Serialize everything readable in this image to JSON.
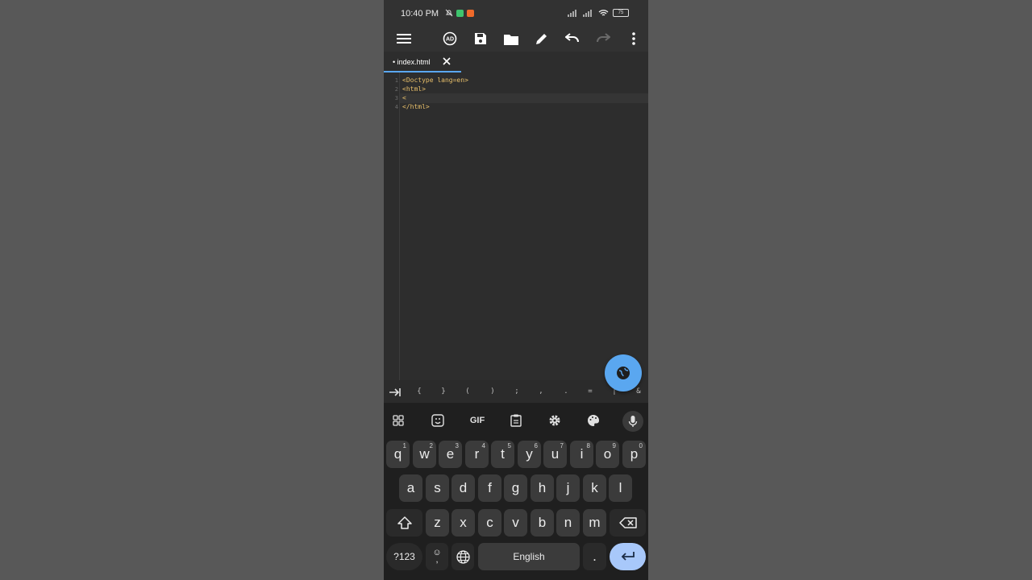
{
  "status": {
    "time": "10:40 PM",
    "battery": "75"
  },
  "toolbar": {
    "icons": [
      "menu-icon",
      "ad-icon",
      "save-icon",
      "folder-icon",
      "pencil-icon",
      "undo-icon",
      "redo-icon",
      "more-vert-icon"
    ]
  },
  "tabs": [
    {
      "label": "• index.html"
    }
  ],
  "editor": {
    "line_numbers": [
      "1",
      "2",
      "3",
      "4"
    ],
    "lines": [
      "<Doctype lang=en>",
      "<html>",
      "<",
      "</html>"
    ]
  },
  "symbols": [
    "{",
    "}",
    "(",
    ")",
    ";",
    ",",
    ".",
    "=",
    "|",
    "&"
  ],
  "keyboard": {
    "gif_label": "GIF",
    "row1": [
      {
        "k": "q",
        "h": "1"
      },
      {
        "k": "w",
        "h": "2"
      },
      {
        "k": "e",
        "h": "3"
      },
      {
        "k": "r",
        "h": "4"
      },
      {
        "k": "t",
        "h": "5"
      },
      {
        "k": "y",
        "h": "6"
      },
      {
        "k": "u",
        "h": "7"
      },
      {
        "k": "i",
        "h": "8"
      },
      {
        "k": "o",
        "h": "9"
      },
      {
        "k": "p",
        "h": "0"
      }
    ],
    "row2": [
      "a",
      "s",
      "d",
      "f",
      "g",
      "h",
      "j",
      "k",
      "l"
    ],
    "row3": [
      "z",
      "x",
      "c",
      "v",
      "b",
      "n",
      "m"
    ],
    "num_label": "?123",
    "emoji_label": "☺",
    "comma_label": ",",
    "space_label": "English",
    "period_label": "."
  },
  "colors": {
    "accent": "#5aa7f0",
    "code": "#e8bf6a",
    "enter": "#a8c8fa"
  }
}
